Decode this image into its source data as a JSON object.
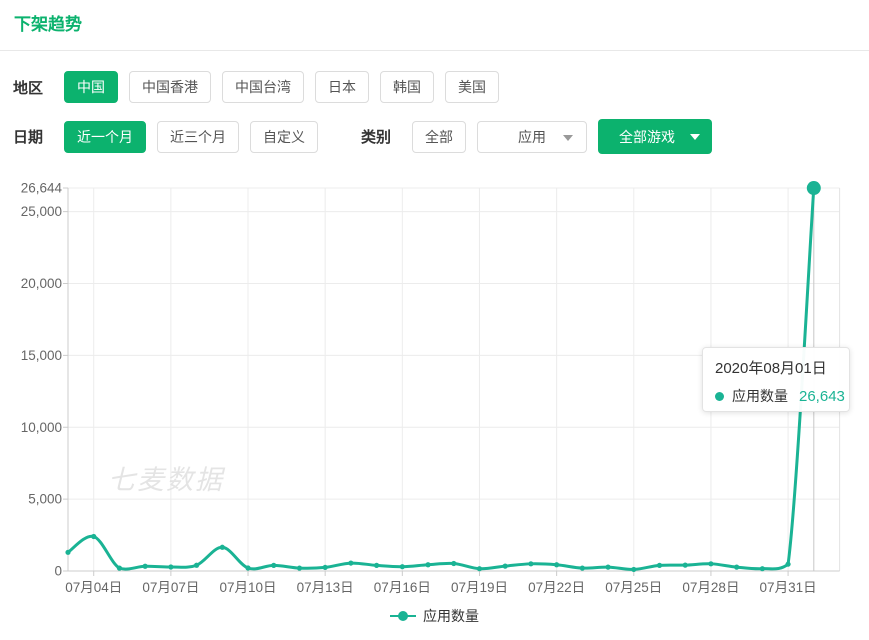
{
  "page": {
    "title": "下架趋势"
  },
  "filters": {
    "region": {
      "label": "地区",
      "options": [
        {
          "label": "中国",
          "active": true
        },
        {
          "label": "中国香港",
          "active": false
        },
        {
          "label": "中国台湾",
          "active": false
        },
        {
          "label": "日本",
          "active": false
        },
        {
          "label": "韩国",
          "active": false
        },
        {
          "label": "美国",
          "active": false
        }
      ]
    },
    "date": {
      "label": "日期",
      "options": [
        {
          "label": "近一个月",
          "active": true
        },
        {
          "label": "近三个月",
          "active": false
        },
        {
          "label": "自定义",
          "active": false
        }
      ]
    },
    "category": {
      "label": "类别",
      "all_button": "全部",
      "app_dropdown_value": "应用",
      "game_dropdown_value": "全部游戏"
    }
  },
  "chart_data": {
    "type": "line",
    "title": "",
    "xlabel": "",
    "ylabel": "",
    "grid": true,
    "legend": [
      "应用数量"
    ],
    "legend_position": "bottom",
    "watermark": "七麦数据",
    "ylim": [
      0,
      26644
    ],
    "y_ticks": [
      0,
      5000,
      10000,
      15000,
      20000,
      25000,
      26644
    ],
    "x_tick_labels": [
      "07月04日",
      "07月07日",
      "07月10日",
      "07月13日",
      "07月16日",
      "07月19日",
      "07月22日",
      "07月25日",
      "07月28日",
      "07月31日"
    ],
    "series": [
      {
        "name": "应用数量",
        "color": "#1ab394",
        "x": [
          "07月03日",
          "07月04日",
          "07月05日",
          "07月06日",
          "07月07日",
          "07月08日",
          "07月09日",
          "07月10日",
          "07月11日",
          "07月12日",
          "07月13日",
          "07月14日",
          "07月15日",
          "07月16日",
          "07月17日",
          "07月18日",
          "07月19日",
          "07月20日",
          "07月21日",
          "07月22日",
          "07月23日",
          "07月24日",
          "07月25日",
          "07月26日",
          "07月27日",
          "07月28日",
          "07月29日",
          "07月30日",
          "07月31日",
          "08月01日"
        ],
        "values": [
          1300,
          2400,
          200,
          330,
          280,
          400,
          1650,
          210,
          390,
          200,
          250,
          550,
          390,
          300,
          435,
          520,
          160,
          340,
          500,
          435,
          200,
          270,
          110,
          390,
          410,
          500,
          270,
          160,
          475,
          26643
        ]
      }
    ],
    "highlighted_point": {
      "x": "08月01日",
      "value": 26643
    }
  },
  "tooltip": {
    "title": "2020年08月01日",
    "series_label": "应用数量",
    "value": "26,643"
  }
}
